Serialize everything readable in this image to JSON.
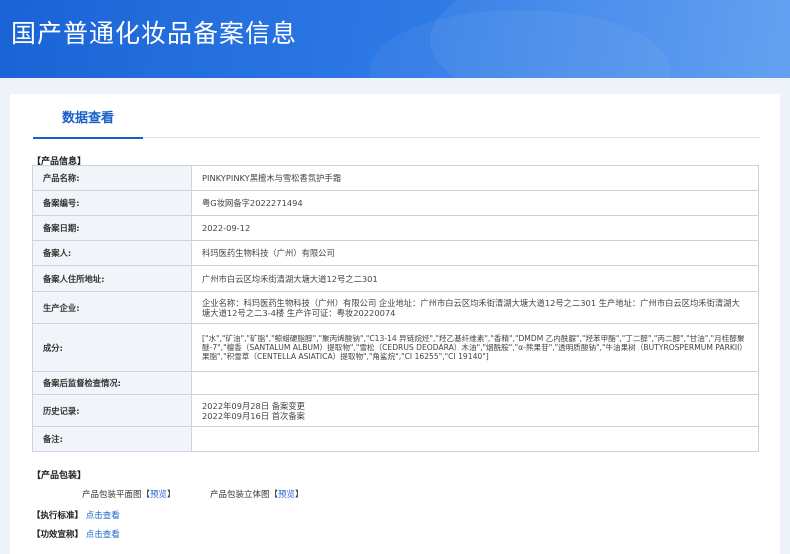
{
  "header": {
    "title": "国产普通化妆品备案信息"
  },
  "tabs": [
    {
      "label": "数据查看",
      "active": true
    }
  ],
  "product_info": {
    "section_title": "【产品信息】",
    "rows": [
      {
        "label": "产品名称:",
        "value": "PINKYPINKY黑檀木与雪松香氛护手霜"
      },
      {
        "label": "备案编号:",
        "value": "粤G妆网备字2022271494"
      },
      {
        "label": "备案日期:",
        "value": "2022-09-12"
      },
      {
        "label": "备案人:",
        "value": "科玛医药生物科技（广州）有限公司"
      },
      {
        "label": "备案人住所地址:",
        "value": "广州市白云区均禾街清湖大塘大道12号之二301"
      },
      {
        "label": "生产企业:",
        "value": "企业名称：科玛医药生物科技（广州）有限公司 企业地址：广州市白云区均禾街清湖大塘大道12号之二301 生产地址：广州市白云区均禾街清湖大塘大道12号之二3-4楼 生产许可证：粤妆20220074"
      },
      {
        "label": "成分:",
        "value": "[\"水\",\"矿油\",\"矿脂\",\"鲸蜡硬脂醇\",\"聚丙烯酸钠\",\"C13-14 异链烷烃\",\"羟乙基纤维素\",\"香精\",\"DMDM 乙内酰脲\",\"羟苯甲酯\",\"丁二醇\",\"丙二醇\",\"甘油\",\"月桂醇聚醚-7\",\"檀香（SANTALUM ALBUM）提取物\",\"雪松（CEDRUS DEODARA）木油\",\"烟酰胺\",\"α-熊果苷\",\"透明质酸钠\",\"牛油果树（BUTYROSPERMUM PARKII）果脂\",\"积雪草（CENTELLA ASIATICA）提取物\",\"角鲨烷\",\"CI 16255\",\"CI 19140\"]"
      },
      {
        "label": "备案后监督检查情况:",
        "value": ""
      },
      {
        "label": "历史记录:",
        "value_lines": [
          "2022年09月28日 备案变更",
          "2022年09月16日 首次备案"
        ]
      },
      {
        "label": "备注:",
        "value": ""
      }
    ]
  },
  "packaging": {
    "section_title": "【产品包装】",
    "items": [
      {
        "label": "产品包装平面图",
        "bracket_open": "【",
        "link": "预览",
        "bracket_close": "】"
      },
      {
        "label": "产品包装立体图",
        "bracket_open": "【",
        "link": "预览",
        "bracket_close": "】"
      }
    ]
  },
  "standard": {
    "label": "【执行标准】",
    "link": "点击查看"
  },
  "efficacy": {
    "label": "【功效宣称】",
    "link": "点击查看"
  }
}
